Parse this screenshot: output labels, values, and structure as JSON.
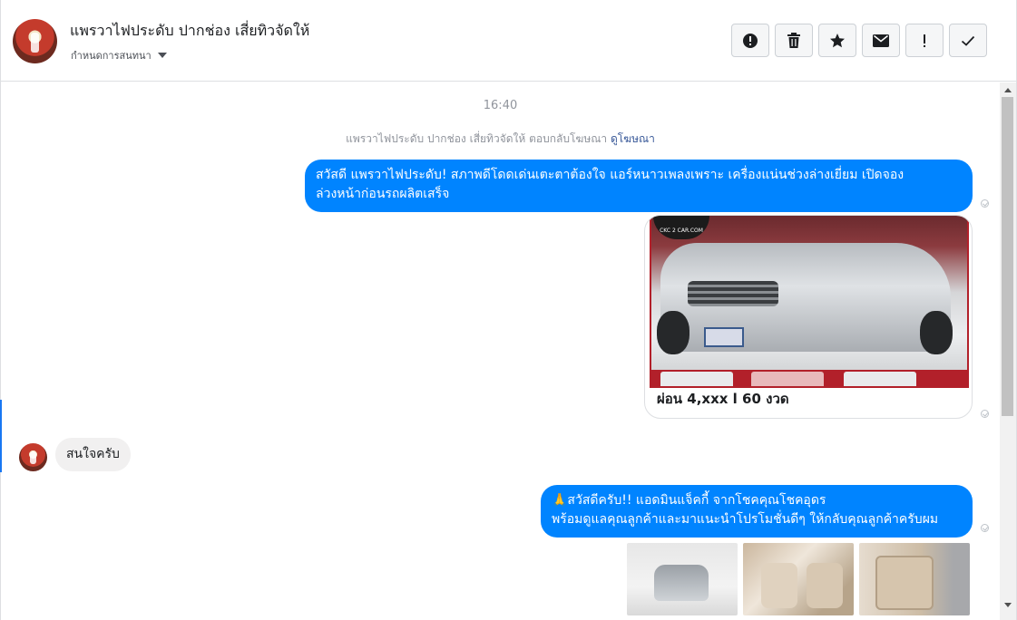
{
  "header": {
    "title": "แพรวาไฟประดับ ปากช่อง เสี่ยทิวจัดให้",
    "subtitle": "กำหนดการสนทนา"
  },
  "toolbar": [
    {
      "name": "report-button",
      "icon": "alert-circle-icon"
    },
    {
      "name": "delete-button",
      "icon": "trash-icon"
    },
    {
      "name": "star-button",
      "icon": "star-icon"
    },
    {
      "name": "mark-unread-button",
      "icon": "envelope-icon"
    },
    {
      "name": "mark-important-button",
      "icon": "exclamation-icon"
    },
    {
      "name": "mark-done-button",
      "icon": "checkmark-icon"
    }
  ],
  "thread": {
    "timestamp": "16:40",
    "ad_reply_text": "แพรวาไฟประดับ ปากช่อง เสี่ยทิวจัดให้ ตอบกลับโฆษณา",
    "ad_link": "ดูโฆษณา",
    "messages": {
      "out_1_line1": "สวัสดี แพรวาไฟประดับ! สภาพดีโดดเด่นเตะตาต้องใจ แอร์หนาวเพลงเพราะ เครื่องแน่นช่วงล่างเยี่ยม เปิดจอง",
      "out_1_line2": "ล่วงหน้าก่อนรถผลิตเสร็จ",
      "car_caption": "ผ่อน 4,xxx l 60 งวด",
      "car_logo": "CKC 2 CAR.COM",
      "in_1": "สนใจครับ",
      "out_2_line1": "🙏สวัสดีครับ!! แอดมินแจ็คกี้ จากโชคคุณโชคอุดร",
      "out_2_line2": "พร้อมดูแลคุณลูกค้าและมาแนะนำโปรโมชั่นดีๆ ให้กลับคุณลูกค้าครับผม"
    }
  },
  "colors": {
    "accent": "#0084ff",
    "incoming_bubble": "#f1f0f0",
    "muted_text": "#90949c",
    "link": "#385898"
  }
}
